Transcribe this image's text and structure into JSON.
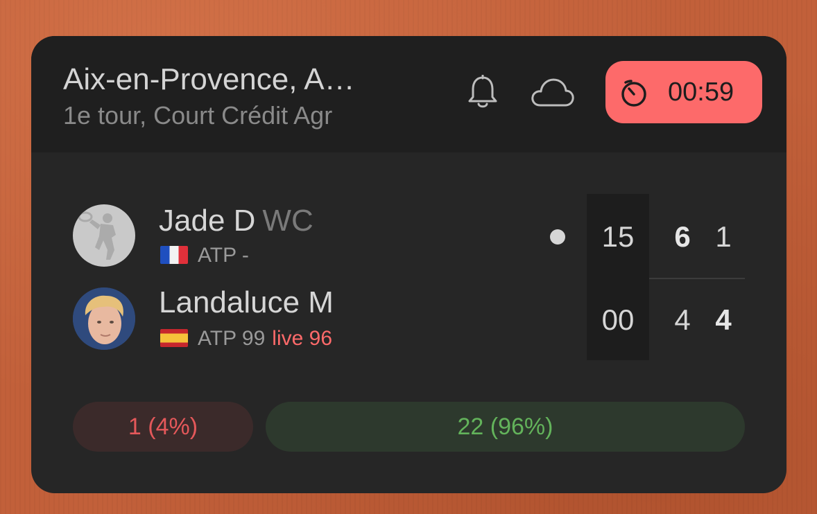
{
  "header": {
    "title": "Aix-en-Provence, A…",
    "subtitle": "1e tour, Court Crédit Agr",
    "icons": [
      "bell-icon",
      "cloud-icon"
    ]
  },
  "timer": {
    "icon": "timer-icon",
    "value": "00:59",
    "color": "#fd6a6a"
  },
  "players": [
    {
      "name": "Jade D",
      "tag": "WC",
      "flag": "flag-france",
      "ranking": "ATP -",
      "live_ranking": "",
      "serving": true,
      "points": "15",
      "sets": [
        "6",
        "1"
      ]
    },
    {
      "name": "Landaluce M",
      "tag": "",
      "flag": "flag-spain",
      "ranking": "ATP 99",
      "live_ranking": "live 96",
      "serving": false,
      "points": "00",
      "sets": [
        "4",
        "4"
      ]
    }
  ],
  "votes": {
    "player1": "1 (4%)",
    "player2": "22 (96%)",
    "player1_color": "#e4585a",
    "player2_color": "#63b35b"
  }
}
